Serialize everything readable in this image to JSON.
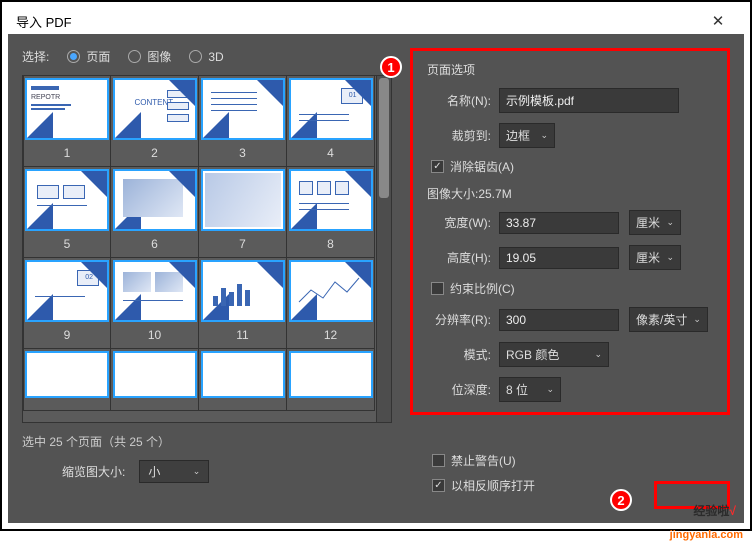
{
  "window": {
    "title": "导入 PDF"
  },
  "select": {
    "label": "选择:",
    "opts": {
      "page": "页面",
      "image": "图像",
      "three_d": "3D"
    },
    "active": "page"
  },
  "pages": [
    "1",
    "2",
    "3",
    "4",
    "5",
    "6",
    "7",
    "8",
    "9",
    "10",
    "11",
    "12"
  ],
  "selected_info": "选中 25 个页面（共 25 个）",
  "thumb_size": {
    "label": "缩览图大小:",
    "value": "小"
  },
  "page_options": {
    "title": "页面选项",
    "name_label": "名称(N):",
    "name_value": "示例模板.pdf",
    "crop_label": "裁剪到:",
    "crop_value": "边框",
    "antialias": "消除锯齿(A)"
  },
  "image_size": {
    "title": "图像大小:25.7M",
    "width_label": "宽度(W):",
    "width_value": "33.87",
    "width_unit": "厘米",
    "height_label": "高度(H):",
    "height_value": "19.05",
    "height_unit": "厘米",
    "constrain": "约束比例(C)",
    "res_label": "分辨率(R):",
    "res_value": "300",
    "res_unit": "像素/英寸",
    "mode_label": "模式:",
    "mode_value": "RGB 颜色",
    "depth_label": "位深度:",
    "depth_value": "8 位"
  },
  "bottom": {
    "suppress": "禁止警告(U)",
    "reverse": "以相反顺序打开"
  },
  "badges": {
    "one": "1",
    "two": "2"
  },
  "watermark": {
    "text1": "经验啦",
    "check": "√",
    "site": "jingyanla.com"
  }
}
